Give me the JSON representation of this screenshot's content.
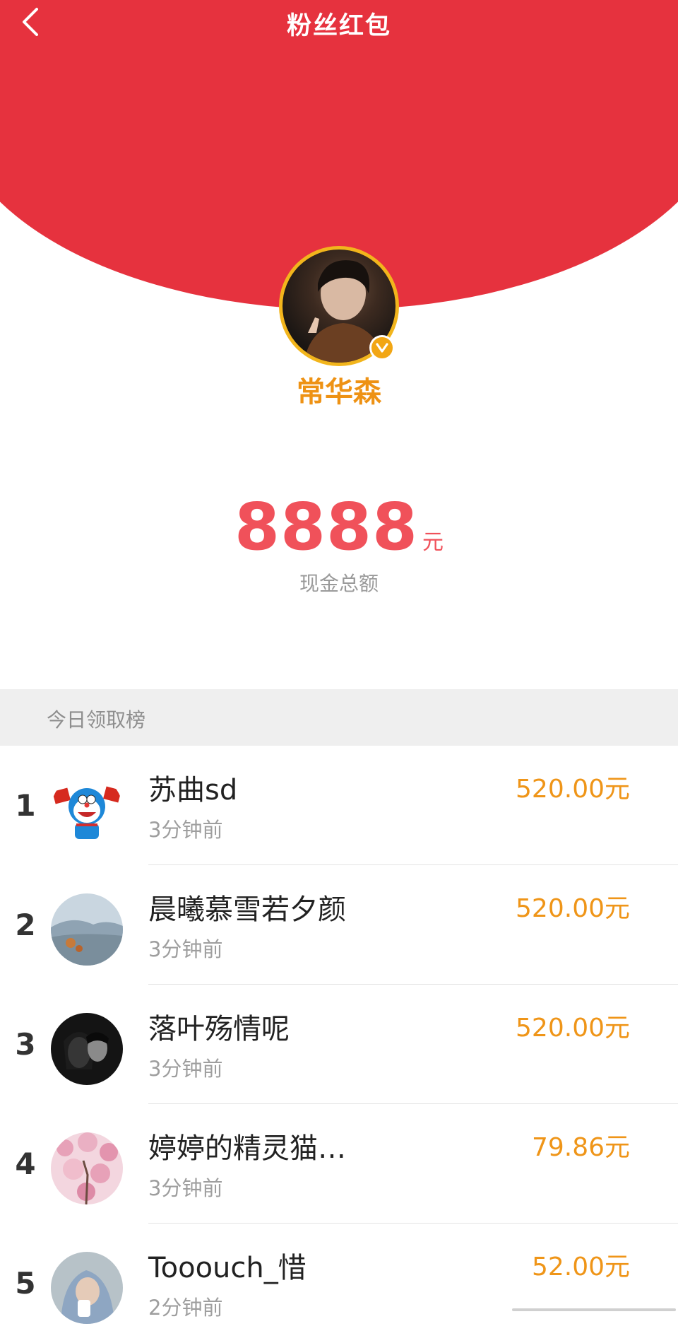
{
  "header": {
    "title": "粉丝红包",
    "back_icon": "chevron-left-icon",
    "bg_color": "#e6323e"
  },
  "profile": {
    "name": "常华森",
    "verified_icon": "verified-check-icon",
    "name_color": "#ee9214"
  },
  "summary": {
    "amount": "8888",
    "unit": "元",
    "label": "现金总额",
    "amount_color": "#f0515a"
  },
  "leaderboard": {
    "title": "今日领取榜",
    "amount_color": "#ef9518",
    "rows": [
      {
        "rank": "1",
        "name": "苏曲sd",
        "time": "3分钟前",
        "amount": "520.00元",
        "avatar": "cartoon-avatar"
      },
      {
        "rank": "2",
        "name": "晨曦慕雪若夕颜",
        "time": "3分钟前",
        "amount": "520.00元",
        "avatar": "landscape-avatar"
      },
      {
        "rank": "3",
        "name": "落叶殇情呢",
        "time": "3分钟前",
        "amount": "520.00元",
        "avatar": "couple-avatar"
      },
      {
        "rank": "4",
        "name": "婷婷的精灵猫…",
        "time": "3分钟前",
        "amount": "79.86元",
        "avatar": "blossom-avatar"
      },
      {
        "rank": "5",
        "name": "Tooouch_惜",
        "time": "2分钟前",
        "amount": "52.00元",
        "avatar": "person-avatar"
      }
    ]
  }
}
